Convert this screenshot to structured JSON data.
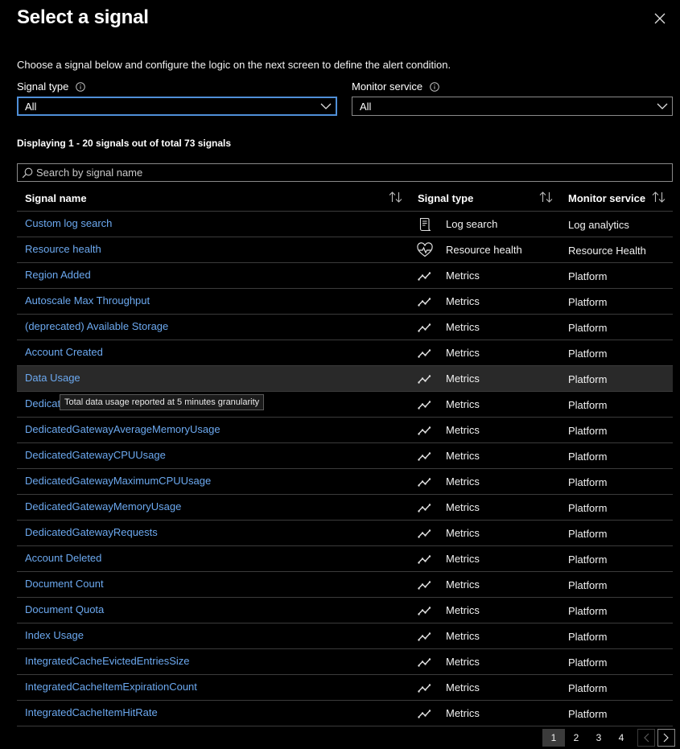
{
  "panel": {
    "title": "Select a signal",
    "description": "Choose a signal below and configure the logic on the next screen to define the alert condition."
  },
  "filters": {
    "signal_type_label": "Signal type",
    "signal_type_value": "All",
    "monitor_service_label": "Monitor service",
    "monitor_service_value": "All"
  },
  "results": {
    "count_text": "Displaying 1 - 20 signals out of total 73 signals"
  },
  "search": {
    "placeholder": "Search by signal name"
  },
  "table": {
    "columns": [
      "Signal name",
      "Signal type",
      "Monitor service"
    ],
    "rows": [
      {
        "name": "Custom log search",
        "type": "Log search",
        "type_icon": "log-search-icon",
        "service": "Log analytics"
      },
      {
        "name": "Resource health",
        "type": "Resource health",
        "type_icon": "heart-pulse-icon",
        "service": "Resource Health"
      },
      {
        "name": "Region Added",
        "type": "Metrics",
        "type_icon": "metrics-icon",
        "service": "Platform"
      },
      {
        "name": "Autoscale Max Throughput",
        "type": "Metrics",
        "type_icon": "metrics-icon",
        "service": "Platform"
      },
      {
        "name": "(deprecated) Available Storage",
        "type": "Metrics",
        "type_icon": "metrics-icon",
        "service": "Platform"
      },
      {
        "name": "Account Created",
        "type": "Metrics",
        "type_icon": "metrics-icon",
        "service": "Platform"
      },
      {
        "name": "Data Usage",
        "type": "Metrics",
        "type_icon": "metrics-icon",
        "service": "Platform"
      },
      {
        "name": "Dedicat",
        "type": "Metrics",
        "type_icon": "metrics-icon",
        "service": "Platform"
      },
      {
        "name": "DedicatedGatewayAverageMemoryUsage",
        "type": "Metrics",
        "type_icon": "metrics-icon",
        "service": "Platform"
      },
      {
        "name": "DedicatedGatewayCPUUsage",
        "type": "Metrics",
        "type_icon": "metrics-icon",
        "service": "Platform"
      },
      {
        "name": "DedicatedGatewayMaximumCPUUsage",
        "type": "Metrics",
        "type_icon": "metrics-icon",
        "service": "Platform"
      },
      {
        "name": "DedicatedGatewayMemoryUsage",
        "type": "Metrics",
        "type_icon": "metrics-icon",
        "service": "Platform"
      },
      {
        "name": "DedicatedGatewayRequests",
        "type": "Metrics",
        "type_icon": "metrics-icon",
        "service": "Platform"
      },
      {
        "name": "Account Deleted",
        "type": "Metrics",
        "type_icon": "metrics-icon",
        "service": "Platform"
      },
      {
        "name": "Document Count",
        "type": "Metrics",
        "type_icon": "metrics-icon",
        "service": "Platform"
      },
      {
        "name": "Document Quota",
        "type": "Metrics",
        "type_icon": "metrics-icon",
        "service": "Platform"
      },
      {
        "name": "Index Usage",
        "type": "Metrics",
        "type_icon": "metrics-icon",
        "service": "Platform"
      },
      {
        "name": "IntegratedCacheEvictedEntriesSize",
        "type": "Metrics",
        "type_icon": "metrics-icon",
        "service": "Platform"
      },
      {
        "name": "IntegratedCacheItemExpirationCount",
        "type": "Metrics",
        "type_icon": "metrics-icon",
        "service": "Platform"
      },
      {
        "name": "IntegratedCacheItemHitRate",
        "type": "Metrics",
        "type_icon": "metrics-icon",
        "service": "Platform"
      }
    ],
    "hovered_row": 6
  },
  "tooltip": {
    "text": "Total data usage reported at 5 minutes granularity"
  },
  "pagination": {
    "pages": [
      "1",
      "2",
      "3",
      "4"
    ],
    "current": "1"
  },
  "colors": {
    "link": "#6ca9f0",
    "focus_border": "#4f8fd8",
    "background": "#000000"
  }
}
